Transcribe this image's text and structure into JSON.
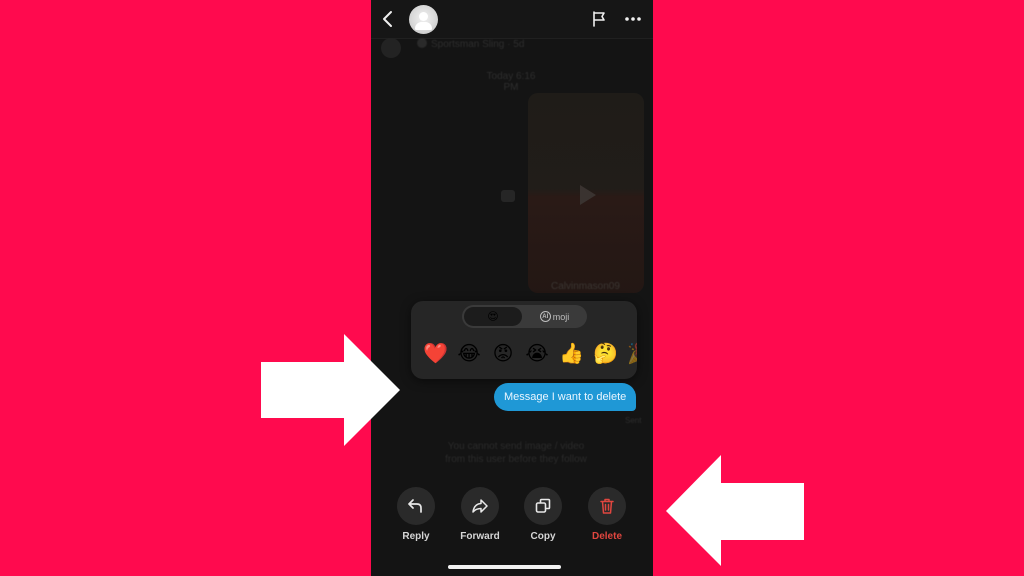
{
  "colors": {
    "page_background": "#ff0a4e",
    "phone_background": "#141414",
    "bubble": "#1f98d6",
    "delete_accent": "#e0463f",
    "arrow": "#ffffff"
  },
  "header": {
    "back_icon": "chevron-left",
    "avatar": "default-user-avatar",
    "flag_icon": "flag",
    "more_icon": "ellipsis-horizontal"
  },
  "background_chat": {
    "sender_name": "Sportsman Sling · 5d",
    "date_separator": "Today 6:16 PM",
    "video_caption": "Calvinmason09",
    "notice_line1": "You cannot send image / video",
    "notice_line2": "from this user before they follow",
    "status": "Sent"
  },
  "reaction_panel": {
    "tabs": [
      {
        "label": "😍",
        "selected": true
      },
      {
        "badge": "AI",
        "label": "moji",
        "selected": false
      }
    ],
    "emojis": [
      "❤️",
      "😂",
      "😡",
      "😭",
      "👍",
      "🤔",
      "🎉"
    ]
  },
  "message": {
    "text": "Message I want to delete"
  },
  "actions": [
    {
      "label": "Reply",
      "icon": "reply"
    },
    {
      "label": "Forward",
      "icon": "forward"
    },
    {
      "label": "Copy",
      "icon": "copy"
    },
    {
      "label": "Delete",
      "icon": "trash"
    }
  ],
  "annotations": [
    {
      "type": "arrow",
      "direction": "right",
      "points_to": "message-bubble"
    },
    {
      "type": "arrow",
      "direction": "left",
      "points_to": "delete-button"
    }
  ]
}
